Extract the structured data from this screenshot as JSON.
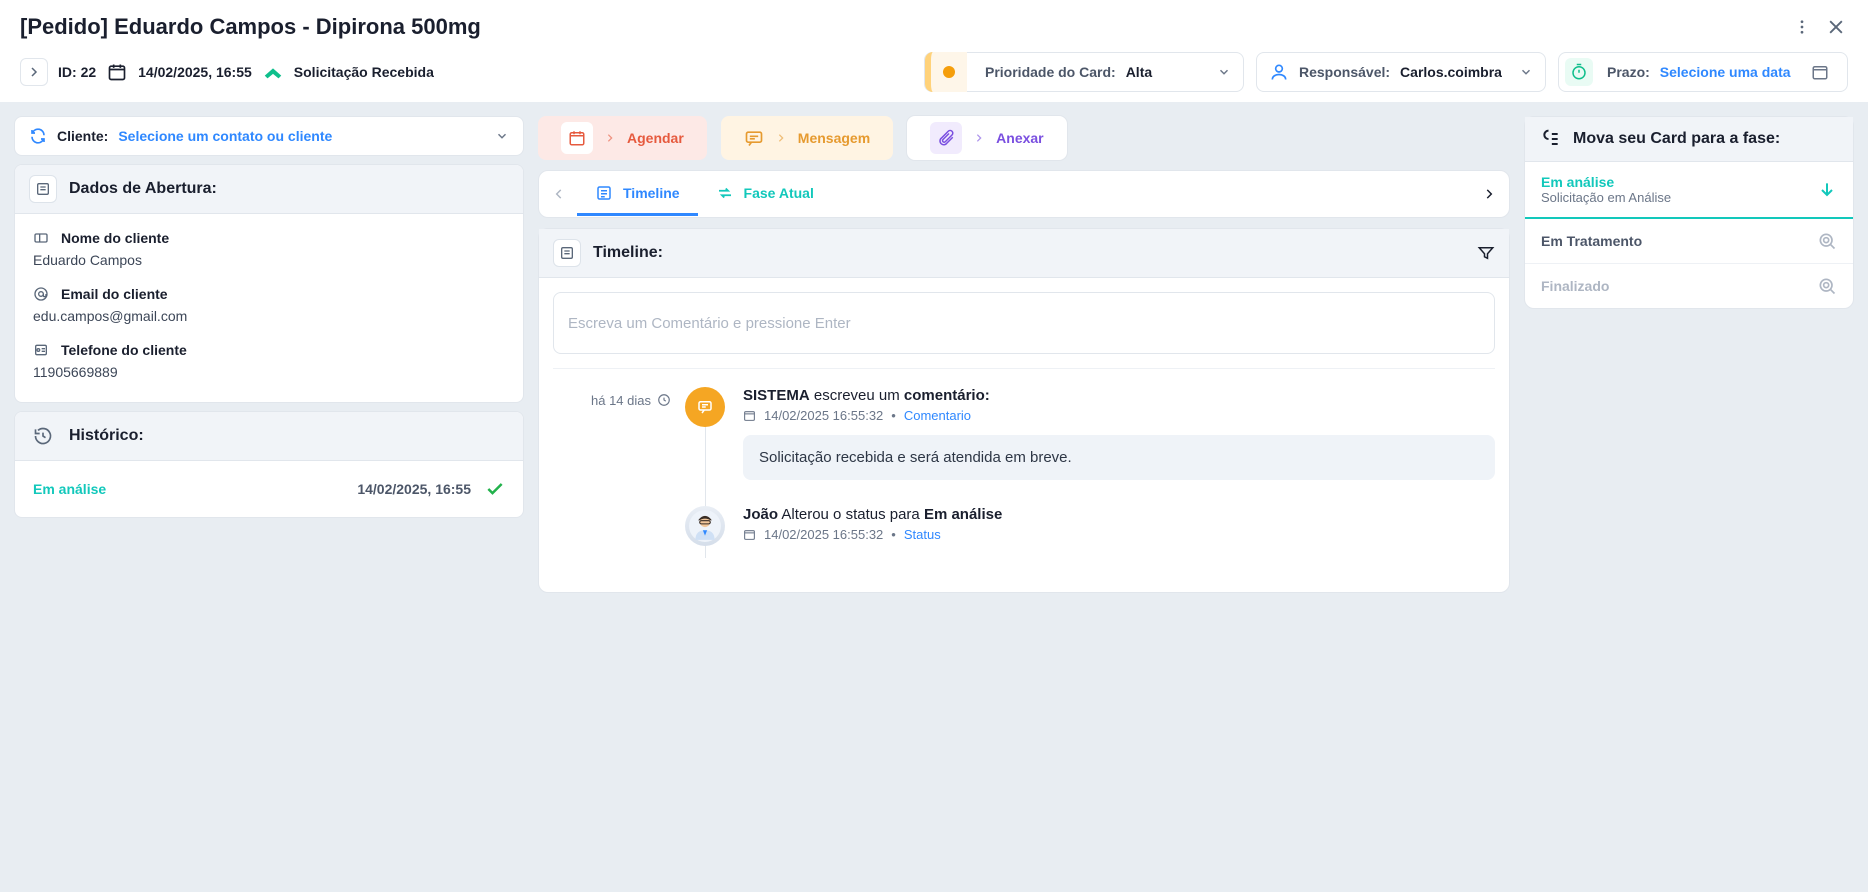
{
  "header": {
    "title": "[Pedido] Eduardo Campos - Dipirona 500mg",
    "id_label": "ID:",
    "id_value": "22",
    "datetime": "14/02/2025, 16:55",
    "status": "Solicitação Recebida",
    "priority": {
      "label": "Prioridade do Card:",
      "value": "Alta"
    },
    "responsible": {
      "label": "Responsável:",
      "value": "Carlos.coimbra"
    },
    "deadline": {
      "label": "Prazo:",
      "placeholder": "Selecione uma data"
    }
  },
  "client_select": {
    "label": "Cliente:",
    "placeholder": "Selecione um contato ou cliente"
  },
  "dados_abertura": {
    "title": "Dados de Abertura:",
    "fields": {
      "nome": {
        "label": "Nome do cliente",
        "value": "Eduardo Campos"
      },
      "email": {
        "label": "Email do cliente",
        "value": "edu.campos@gmail.com"
      },
      "telefone": {
        "label": "Telefone do cliente",
        "value": "11905669889"
      }
    }
  },
  "historico": {
    "title": "Histórico:",
    "item": {
      "name": "Em análise",
      "date": "14/02/2025, 16:55"
    }
  },
  "actions": {
    "agendar": "Agendar",
    "mensagem": "Mensagem",
    "anexar": "Anexar"
  },
  "tabs": {
    "timeline": "Timeline",
    "fase": "Fase Atual"
  },
  "timeline": {
    "title": "Timeline:",
    "input_placeholder": "Escreva um Comentário e pressione Enter",
    "relative": "há 14 dias",
    "entry1": {
      "author": "SISTEMA",
      "verb": "escreveu um",
      "noun": "comentário:",
      "timestamp": "14/02/2025 16:55:32",
      "tag": "Comentario",
      "body": "Solicitação recebida e será atendida em breve."
    },
    "entry2": {
      "author": "João",
      "verb": "Alterou o status para",
      "target": "Em análise",
      "timestamp": "14/02/2025 16:55:32",
      "tag": "Status"
    }
  },
  "phases": {
    "title": "Mova seu Card para a fase:",
    "items": {
      "p1": {
        "name": "Em análise",
        "sub": "Solicitação em Análise"
      },
      "p2": {
        "name": "Em Tratamento"
      },
      "p3": {
        "name": "Finalizado"
      }
    }
  }
}
